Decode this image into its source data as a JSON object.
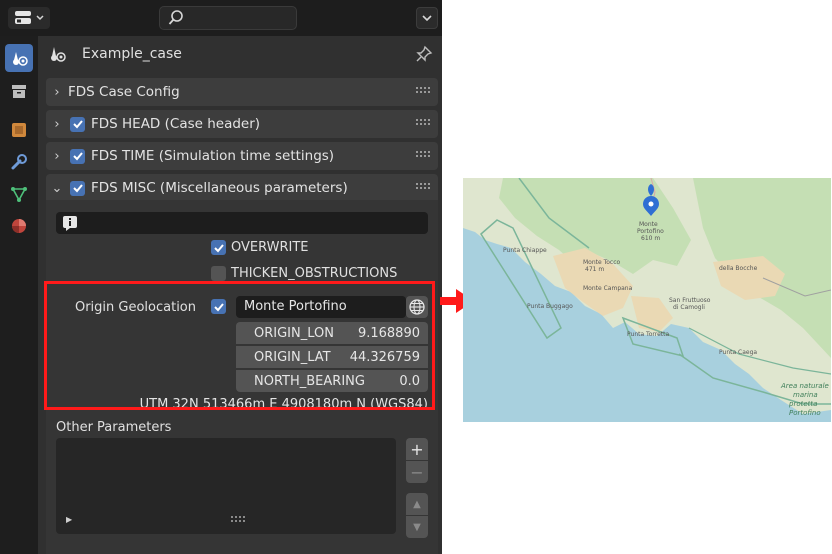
{
  "search": {
    "placeholder": ""
  },
  "context": {
    "name": "Example_case"
  },
  "panels": [
    {
      "title": "FDS Case Config",
      "expanded": false,
      "has_checkbox": false
    },
    {
      "title": "FDS HEAD (Case header)",
      "expanded": false,
      "has_checkbox": true,
      "checked": true
    },
    {
      "title": "FDS TIME (Simulation time settings)",
      "expanded": false,
      "has_checkbox": true,
      "checked": true
    },
    {
      "title": "FDS MISC (Miscellaneous parameters)",
      "expanded": true,
      "has_checkbox": true,
      "checked": true
    }
  ],
  "misc": {
    "overwrite": {
      "label": "OVERWRITE",
      "checked": true
    },
    "thicken": {
      "label": "THICKEN_OBSTRUCTIONS",
      "checked": false
    },
    "geo": {
      "label": "Origin Geolocation",
      "checked": true,
      "name": "Monte Portofino",
      "fields": [
        {
          "label": "ORIGIN_LON",
          "value": "9.168890"
        },
        {
          "label": "ORIGIN_LAT",
          "value": "44.326759"
        },
        {
          "label": "NORTH_BEARING",
          "value": "0.0"
        }
      ],
      "utm": "UTM 32N 513466m E 4908180m N (WGS84)"
    },
    "other": {
      "label": "Other Parameters"
    },
    "list_buttons": {
      "add": "+",
      "remove": "−"
    }
  },
  "map": {
    "labels": {
      "monte": "Monte",
      "monte_sub": "Portofino",
      "monte_alt": "610 m",
      "chiappe": "Punta Chiappe",
      "monte_tocco": "Monte Tocco",
      "monte_tocco_alt": "471 m",
      "della_bocche": "della Bocche",
      "punta_bussago": "Punta Buggago",
      "monte_campana": "Monte Campana",
      "san_fruttuoso": "San Fruttuoso",
      "di_camogli": "di Camogli",
      "punta_torretta": "Punta Torretta",
      "punta_caega": "Punta Caega",
      "area_1": "Area naturale",
      "area_2": "marina",
      "area_3": "protetta",
      "area_4": "Portofino"
    },
    "colors": {
      "sea": "#a8d0de",
      "land": "#dfe6cf",
      "forest": "#c5dfb4",
      "urban": "#ead9b4",
      "marker": "#2f6fd3"
    }
  },
  "colors": {
    "accent": "#4772b3",
    "highlight": "#ff1a1a"
  }
}
